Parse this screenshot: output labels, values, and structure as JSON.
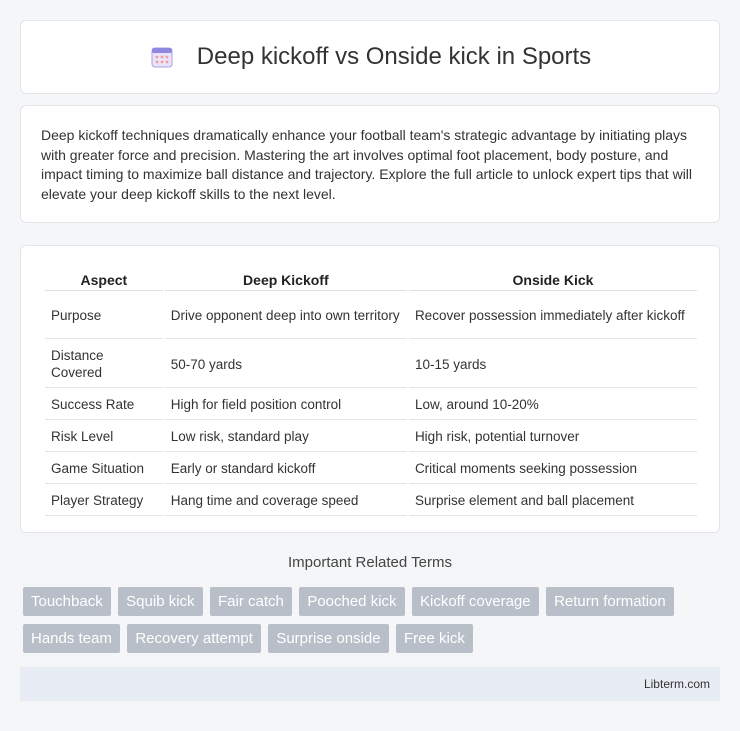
{
  "header": {
    "title": "Deep kickoff vs Onside kick in Sports",
    "icon": "calendar-icon"
  },
  "intro": {
    "text": "Deep kickoff techniques dramatically enhance your football team's strategic advantage by initiating plays with greater force and precision. Mastering the art involves optimal foot placement, body posture, and impact timing to maximize ball distance and trajectory. Explore the full article to unlock expert tips that will elevate your deep kickoff skills to the next level."
  },
  "table": {
    "headers": [
      "Aspect",
      "Deep Kickoff",
      "Onside Kick"
    ],
    "rows": [
      [
        "Purpose",
        "Drive opponent deep into own territory",
        "Recover possession immediately after kickoff"
      ],
      [
        "Distance Covered",
        "50-70 yards",
        "10-15 yards"
      ],
      [
        "Success Rate",
        "High for field position control",
        "Low, around 10-20%"
      ],
      [
        "Risk Level",
        "Low risk, standard play",
        "High risk, potential turnover"
      ],
      [
        "Game Situation",
        "Early or standard kickoff",
        "Critical moments seeking possession"
      ],
      [
        "Player Strategy",
        "Hang time and coverage speed",
        "Surprise element and ball placement"
      ]
    ]
  },
  "related": {
    "title": "Important Related Terms",
    "tags": [
      "Touchback",
      "Squib kick",
      "Fair catch",
      "Pooched kick",
      "Kickoff coverage",
      "Return formation",
      "Hands team",
      "Recovery attempt",
      "Surprise onside",
      "Free kick"
    ]
  },
  "footer": {
    "site": "Libterm.com"
  }
}
